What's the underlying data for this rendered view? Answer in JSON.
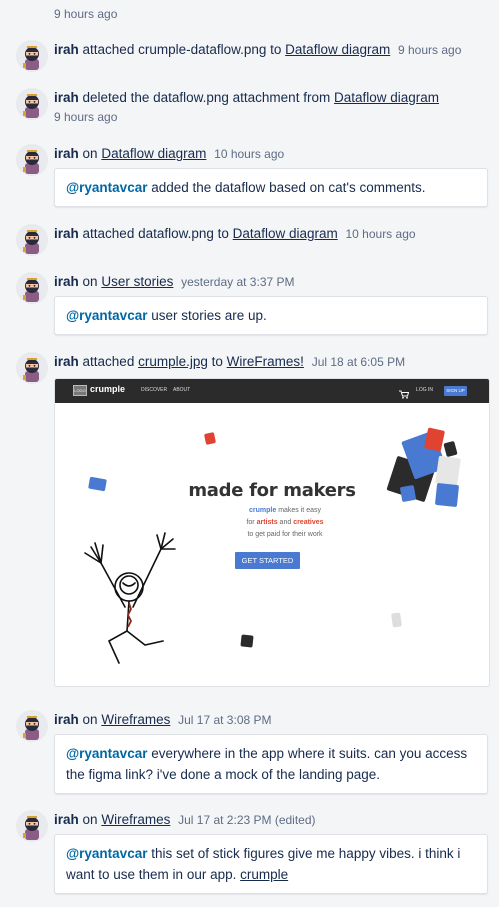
{
  "feed": {
    "top_time": "9 hours ago",
    "entries": [
      {
        "user": "irah",
        "action": "attached crumple-dataflow.png to",
        "target": "Dataflow diagram",
        "time": "9 hours ago"
      },
      {
        "user": "irah",
        "action": "deleted the dataflow.png attachment from",
        "target": "Dataflow diagram",
        "time": "9 hours ago"
      },
      {
        "user": "irah",
        "action": "on",
        "target": "Dataflow diagram",
        "time": "10 hours ago",
        "comment_mention": "@ryantavcar",
        "comment_text": "added the dataflow based on cat's comments."
      },
      {
        "user": "irah",
        "action": "attached dataflow.png to",
        "target": "Dataflow diagram",
        "time": "10 hours ago"
      },
      {
        "user": "irah",
        "action": "on",
        "target": "User stories",
        "time": "yesterday at 3:37 PM",
        "comment_mention": "@ryantavcar",
        "comment_text": "user stories are up."
      },
      {
        "user": "irah",
        "action": "attached",
        "file": "crumple.jpg",
        "to": "to",
        "target": "WireFrames!",
        "time": "Jul 18 at 6:05 PM",
        "attachment": {
          "logo_box": "LOGO",
          "logo": "crumple",
          "nav_discover": "DISCOVER",
          "nav_about": "ABOUT",
          "nav_login": "LOG IN",
          "nav_signup": "SIGN UP",
          "title": "made for makers",
          "sub1_brand": "crumple",
          "sub1_rest": "makes it easy",
          "sub2_for": "for",
          "sub2_artists": "artists",
          "sub2_and": "and",
          "sub2_creatives": "creatives",
          "sub3": "to get paid for their work",
          "cta": "GET STARTED",
          "colors": {
            "blue": "#4a79d1",
            "red": "#e0432f",
            "dark": "#2b2b2b"
          }
        }
      },
      {
        "user": "irah",
        "action": "on",
        "target": "Wireframes",
        "time": "Jul 17 at 3:08 PM",
        "comment_mention": "@ryantavcar",
        "comment_text": "everywhere in the app where it suits. can you access the figma link? i've done a mock of the landing page."
      },
      {
        "user": "irah",
        "action": "on",
        "target": "Wireframes",
        "time": "Jul 17 at 2:23 PM (edited)",
        "comment_mention": "@ryantavcar",
        "comment_text": "this set of stick figures give me happy vibes. i think i want to use them in our app.",
        "comment_link": "crumple"
      }
    ]
  },
  "colors": {
    "background": "#f4f5f7",
    "text": "#172b4d",
    "muted": "#5e6c84",
    "mention": "#0067a3"
  },
  "icons": [
    "ninja-avatar-icon",
    "cart-icon"
  ]
}
